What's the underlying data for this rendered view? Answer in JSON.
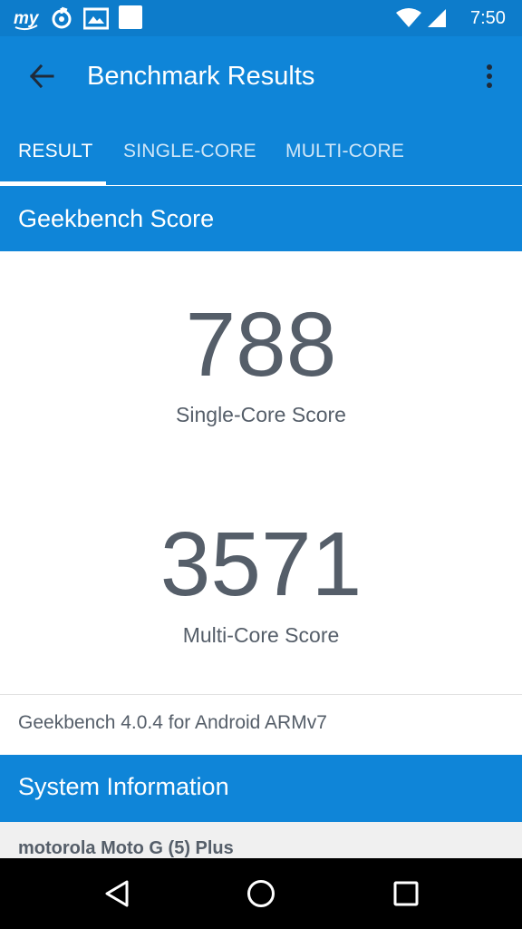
{
  "status_bar": {
    "time": "7:50",
    "notification_icons": [
      "myntra-icon",
      "music-notification-icon",
      "gallery-notification-icon",
      "blank-notification-icon"
    ],
    "system_icons": [
      "wifi-icon",
      "signal-icon"
    ]
  },
  "app_bar": {
    "title": "Benchmark Results",
    "back_icon": "arrow-left-icon",
    "menu_icon": "more-vert-icon"
  },
  "tabs": [
    {
      "label": "RESULT",
      "active": true
    },
    {
      "label": "SINGLE-CORE",
      "active": false
    },
    {
      "label": "MULTI-CORE",
      "active": false
    }
  ],
  "geekbench_section": {
    "header": "Geekbench Score",
    "single_core": {
      "value": "788",
      "label": "Single-Core Score"
    },
    "multi_core": {
      "value": "3571",
      "label": "Multi-Core Score"
    },
    "version": "Geekbench 4.0.4 for Android ARMv7"
  },
  "system_section": {
    "header": "System Information",
    "device": "motorola Moto G (5) Plus"
  },
  "colors": {
    "primary": "#0f85d8",
    "primary_dark": "#0d7ccb",
    "text_gray": "#555e69"
  },
  "nav_bar": {
    "icons": [
      "back-triangle-icon",
      "home-circle-icon",
      "recents-square-icon"
    ]
  }
}
